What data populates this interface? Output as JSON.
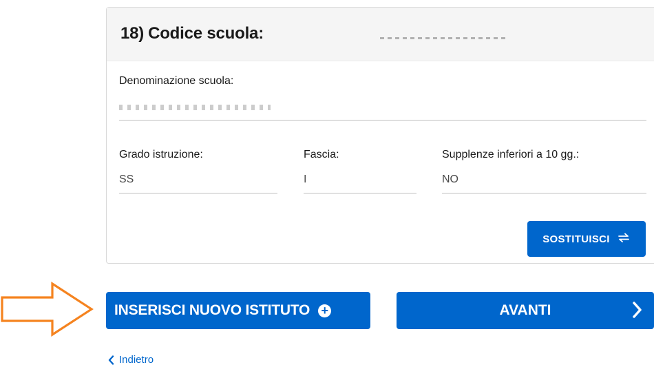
{
  "school_card": {
    "number": "18)",
    "code_label": "Codice scuola:",
    "code_value": "",
    "denomination_label": "Denominazione scuola:",
    "denomination_value": "",
    "grado_label": "Grado istruzione:",
    "grado_value": "SS",
    "fascia_label": "Fascia:",
    "fascia_value": "I",
    "supplenze_label": "Supplenze inferiori a 10 gg.:",
    "supplenze_value": "NO",
    "replace_button": "SOSTITUISCI"
  },
  "actions": {
    "insert_label": "INSERISCI NUOVO ISTITUTO",
    "next_label": "AVANTI",
    "back_label": "Indietro"
  },
  "icons": {
    "replace": "swap-arrows-icon",
    "insert": "plus-circle-icon",
    "next": "chevron-right-icon",
    "back": "chevron-left-icon",
    "pointer": "orange-arrow-icon"
  },
  "colors": {
    "primary": "#0066cc",
    "arrow": "#f5831f",
    "header_bg": "#f5f5f5"
  }
}
